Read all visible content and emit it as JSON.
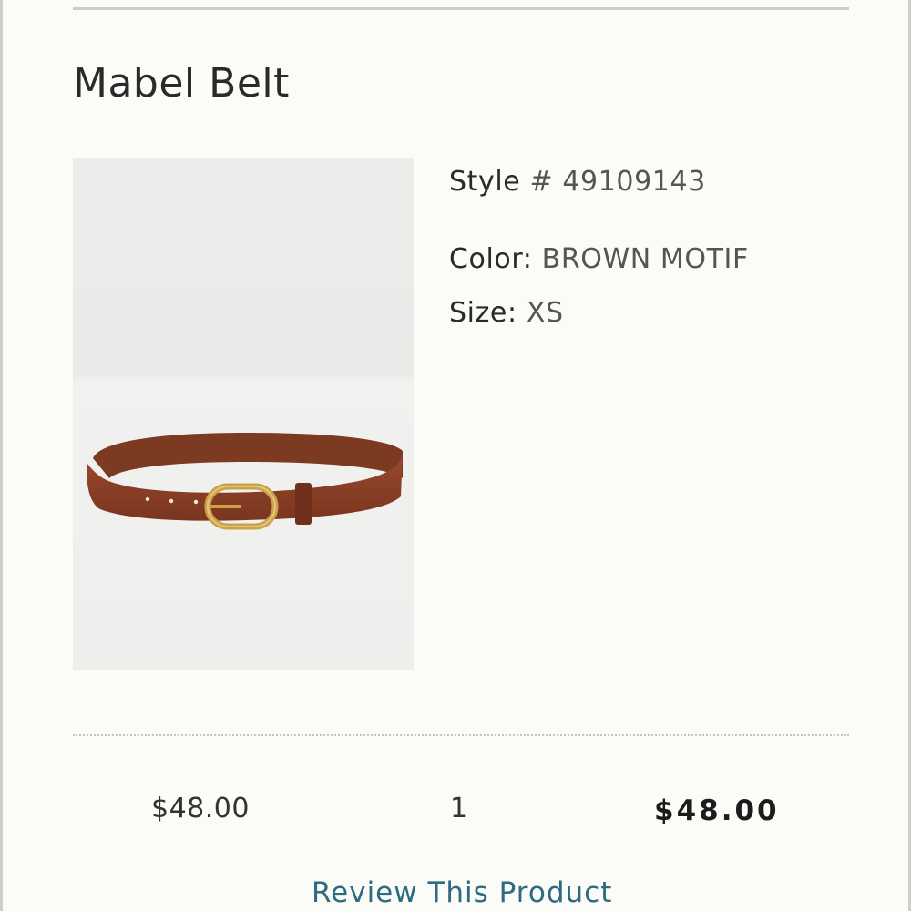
{
  "product": {
    "name": "Mabel Belt",
    "image_alt": "Brown leather belt with gold oval buckle",
    "style_label": "Style",
    "style_value": "# 49109143",
    "color_label": "Color:",
    "color_value": "BROWN MOTIF",
    "size_label": "Size:",
    "size_value": "XS"
  },
  "pricing": {
    "unit_price": "$48.00",
    "quantity": "1",
    "total_price": "$48.00"
  },
  "actions": {
    "review_label": "Review This Product"
  },
  "colors": {
    "background": "#fbfbf7",
    "link": "#2d6c80",
    "belt_leather": "#8b3f24",
    "buckle_gold": "#c9a24a"
  }
}
